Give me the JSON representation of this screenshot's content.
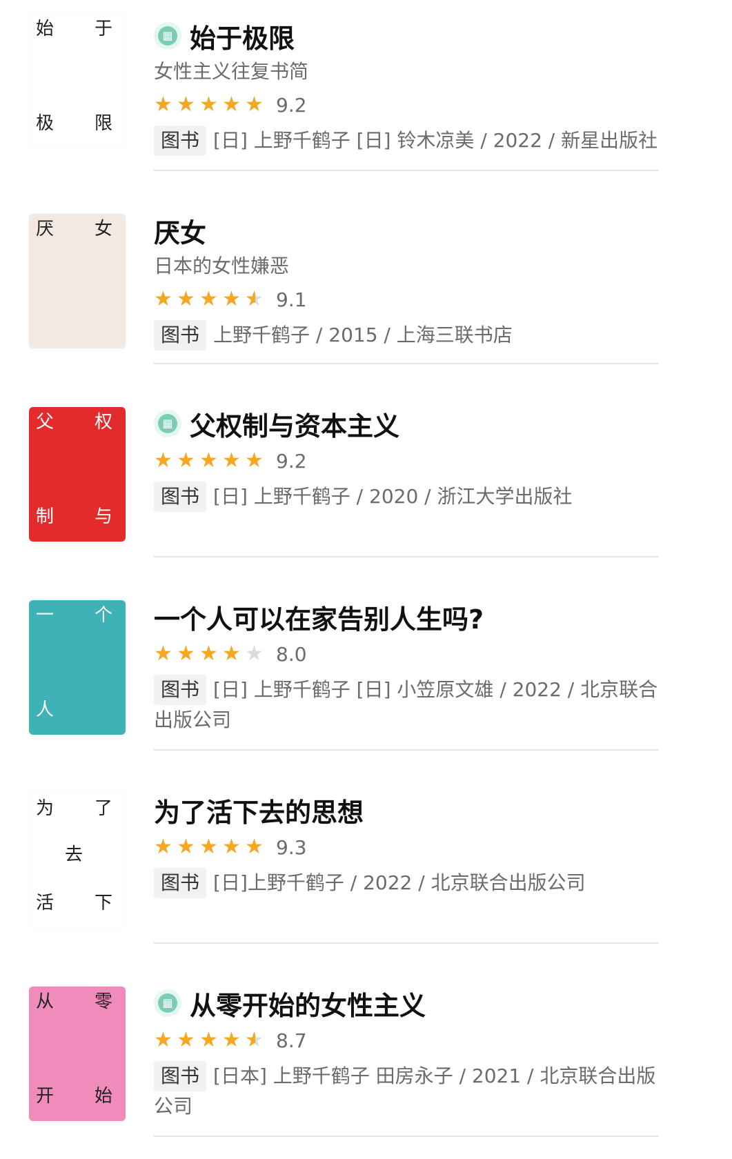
{
  "books": [
    {
      "title": "始于极限",
      "subtitle": "女性主义往复书简",
      "rating": 9.2,
      "rating_text": "9.2",
      "stars": 5,
      "has_read_badge": true,
      "tag": "图书",
      "meta": "[日] 上野千鹤子 [日] 铃木凉美 / 2022 / 新星出版社",
      "cover": {
        "bg": "#ffffff",
        "lines": [
          "始",
          "于",
          "极",
          "限"
        ]
      }
    },
    {
      "title": "厌女",
      "subtitle": "日本的女性嫌恶",
      "rating": 9.1,
      "rating_text": "9.1",
      "stars": 4.5,
      "has_read_badge": false,
      "tag": "图书",
      "meta": "上野千鹤子 / 2015 / 上海三联书店",
      "cover": {
        "bg": "#f3e9e2",
        "lines": [
          "厌",
          "女"
        ]
      }
    },
    {
      "title": "父权制与资本主义",
      "subtitle": "",
      "rating": 9.2,
      "rating_text": "9.2",
      "stars": 5,
      "has_read_badge": true,
      "tag": "图书",
      "meta": "[日] 上野千鹤子 / 2020 / 浙江大学出版社",
      "cover": {
        "bg": "#e42b2b",
        "lines": [
          "父",
          "权",
          "制",
          "与"
        ]
      }
    },
    {
      "title": "一个人可以在家告别人生吗?",
      "subtitle": "",
      "rating": 8.0,
      "rating_text": "8.0",
      "stars": 4,
      "has_read_badge": false,
      "tag": "图书",
      "meta": "[日] 上野千鹤子 [日] 小笠原文雄 / 2022 / 北京联合出版公司",
      "cover": {
        "bg": "#3fb2b7",
        "lines": [
          "一",
          "个",
          "人"
        ]
      }
    },
    {
      "title": "为了活下去的思想",
      "subtitle": "",
      "rating": 9.3,
      "rating_text": "9.3",
      "stars": 5,
      "has_read_badge": false,
      "tag": "图书",
      "meta": "[日]上野千鹤子 / 2022 / 北京联合出版公司",
      "cover": {
        "bg": "#ffffff",
        "lines": [
          "为",
          "了",
          "活",
          "下",
          "去"
        ]
      }
    },
    {
      "title": "从零开始的女性主义",
      "subtitle": "",
      "rating": 8.7,
      "rating_text": "8.7",
      "stars": 4.5,
      "has_read_badge": true,
      "tag": "图书",
      "meta": "[日本] 上野千鹤子 田房永子 / 2021 / 北京联合出版公司",
      "cover": {
        "bg": "#f08cbc",
        "lines": [
          "从",
          "零",
          "开",
          "始"
        ]
      }
    }
  ],
  "icons": {
    "read_badge": "book-icon",
    "star": "star-icon"
  },
  "colors": {
    "star": "#f5a623",
    "star_empty": "#dcdcdc",
    "badge": "#7ccdb6"
  }
}
